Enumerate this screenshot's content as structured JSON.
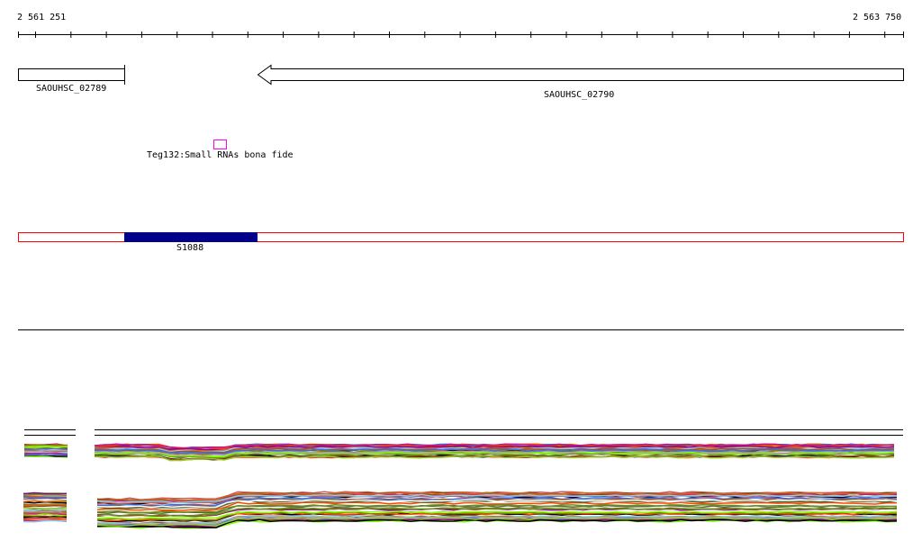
{
  "ruler": {
    "start_label": "2 561 251",
    "end_label": "2 563 750"
  },
  "genes": [
    {
      "name": "SAOUHSC_02789",
      "strand": "+"
    },
    {
      "name": "SAOUHSC_02790",
      "strand": "-"
    }
  ],
  "srna": {
    "label": "Teg132:Small RNAs bona fide",
    "color": "#ff00ff"
  },
  "region": {
    "label": "S1088",
    "fill": "#00008b",
    "outline": "#ff0000"
  }
}
